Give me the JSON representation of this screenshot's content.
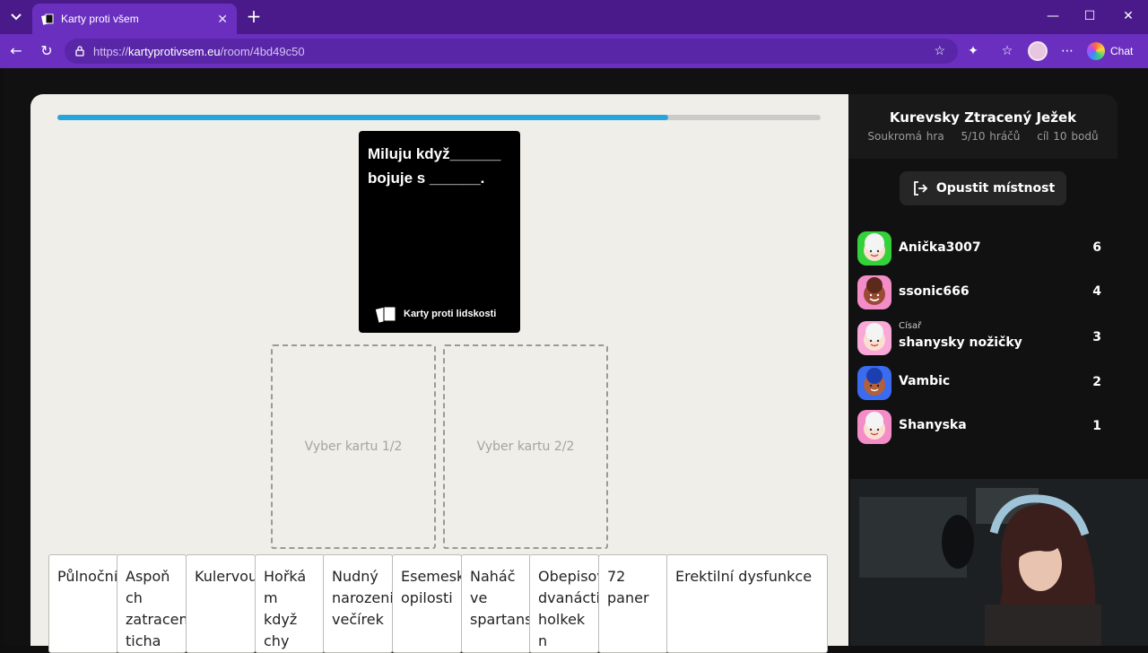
{
  "browser": {
    "tab_title": "Karty proti všem",
    "url_protocol": "https://",
    "url_host": "kartyprotivsem.eu",
    "url_path": "/room/4bd49c50",
    "chat_label": "Chat"
  },
  "game": {
    "progress_fraction": 0.8,
    "black_card_text": "Miluju když______\nbojuje s ______.",
    "brand": "Karty proti lidskosti",
    "slots": [
      "Vyber kartu 1/2",
      "Vyber kartu 2/2"
    ],
    "hand": [
      "Půlnoční",
      "Aspoň ch\nzatracen\nticha",
      "Kulervou",
      "Hořká m\nkdyž chy\npokémo",
      "Nudný\nnarozeni\nvečírek",
      "Esemesk\nopilosti",
      "Naháč ve\nspartans",
      "Obepisov\ndvanácti\nholkek n",
      "72 paner",
      "Erektilní dysfunkce"
    ]
  },
  "room": {
    "name": "Kurevsky Ztracený Ježek",
    "privacy": "Soukromá hra",
    "players_count": "5/10 hráčů",
    "goal": "cíl 10 bodů",
    "leave_label": "Opustit místnost"
  },
  "players": [
    {
      "name": "Anička3007",
      "title": "",
      "score": "6",
      "avatar_color": "#35d13a"
    },
    {
      "name": "ssonic666",
      "title": "",
      "score": "4",
      "avatar_color": "#f48cc8"
    },
    {
      "name": "shanysky nožičky",
      "title": "Císař",
      "score": "3",
      "avatar_color": "#f9a8d8"
    },
    {
      "name": "Vambic",
      "title": "",
      "score": "2",
      "avatar_color": "#3b6cf0"
    },
    {
      "name": "Shanyska",
      "title": "",
      "score": "1",
      "avatar_color": "#f48cc8"
    }
  ],
  "colors": {
    "accent": "#27a5dc",
    "browser_frame": "#6b2fc0",
    "game_bg": "#efeee9"
  }
}
